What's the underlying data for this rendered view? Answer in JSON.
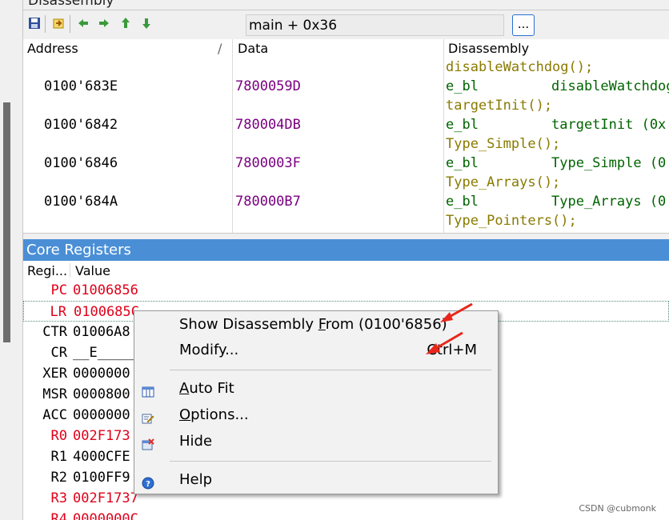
{
  "disassembly_panel": {
    "title": "Disassembly",
    "toolbar": {
      "address_value": "main + 0x36",
      "browse_label": "..."
    },
    "columns": [
      "Address",
      "Data",
      "Disassembly"
    ],
    "col_marker": "/",
    "lines": [
      {
        "type": "src",
        "text": "disableWatchdog();"
      },
      {
        "type": "ins",
        "address": "0100'683E",
        "data": "7800059D",
        "mnemonic": "e_bl",
        "operand": "disableWatchdog"
      },
      {
        "type": "src",
        "text": "targetInit();"
      },
      {
        "type": "ins",
        "address": "0100'6842",
        "data": "780004DB",
        "mnemonic": "e_bl",
        "operand": "targetInit (0x"
      },
      {
        "type": "src",
        "text": "Type_Simple();"
      },
      {
        "type": "ins",
        "address": "0100'6846",
        "data": "7800003F",
        "mnemonic": "e_bl",
        "operand": "Type_Simple (0"
      },
      {
        "type": "src",
        "text": "Type_Arrays();"
      },
      {
        "type": "ins",
        "address": "0100'684A",
        "data": "780000B7",
        "mnemonic": "e_bl",
        "operand": "Type_Arrays (0"
      },
      {
        "type": "src",
        "text": "Type_Pointers();"
      }
    ]
  },
  "registers_panel": {
    "title": "Core Registers",
    "columns": [
      "Regi...",
      "Value"
    ],
    "rows": [
      {
        "name": "PC",
        "value": "01006856",
        "color": "#e0001a"
      },
      {
        "name": "LR",
        "value": "0100685C",
        "color": "#e0001a"
      },
      {
        "name": "CTR",
        "value": "01006A8",
        "color": "#000000"
      },
      {
        "name": "CR",
        "value": "__E_____",
        "color": "#000000"
      },
      {
        "name": "XER",
        "value": "0000000",
        "color": "#000000"
      },
      {
        "name": "MSR",
        "value": "0000800",
        "color": "#000000"
      },
      {
        "name": "ACC",
        "value": "0000000",
        "color": "#000000"
      },
      {
        "name": "R0",
        "value": "002F173",
        "color": "#e0001a"
      },
      {
        "name": "R1",
        "value": "4000CFE",
        "color": "#000000"
      },
      {
        "name": "R2",
        "value": "0100FF9",
        "color": "#000000"
      },
      {
        "name": "R3",
        "value": "002F1737",
        "color": "#e0001a"
      },
      {
        "name": "R4",
        "value": "0000000C",
        "color": "#e0001a"
      }
    ]
  },
  "context_menu": {
    "show_disasm_pre": "Show Disassembly ",
    "show_disasm_u": "F",
    "show_disasm_post": "rom (0100'6856)",
    "modify": "Modify...",
    "modify_shortcut": "Ctrl+M",
    "autofit_u": "A",
    "autofit_post": "uto Fit",
    "options_u": "O",
    "options_post": "ptions...",
    "hide": "Hide",
    "help": "Help"
  },
  "colors": {
    "address": "#000000",
    "data": "#7a0080",
    "source": "#8a7a00",
    "mnemonic": "#006400",
    "panel_title_bg": "#4a8fd6",
    "annotation_arrow": "#e8261a"
  },
  "watermark": "CSDN @cubmonk"
}
